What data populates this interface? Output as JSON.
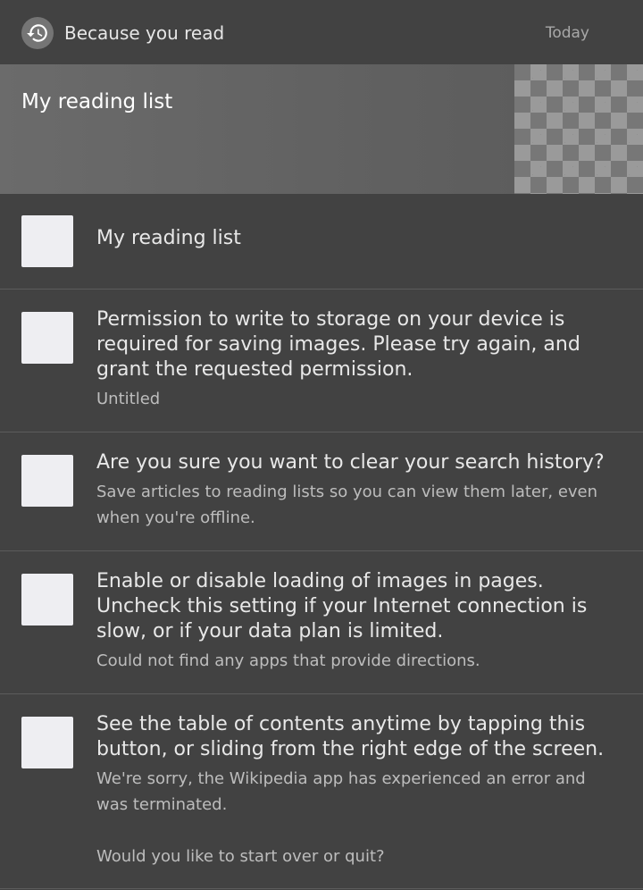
{
  "header": {
    "icon": "history-icon",
    "title": "Because you read",
    "date": "Today"
  },
  "banner": {
    "title": "My reading list",
    "thumbnail": "placeholder-image"
  },
  "items": [
    {
      "title": "My reading list",
      "subtitle": ""
    },
    {
      "title": "Permission to write to storage on your device is required for saving images. Please try again, and grant the requested permission.",
      "subtitle": "Untitled"
    },
    {
      "title": "Are you sure you want to clear your search history?",
      "subtitle": "Save articles to reading lists so you can view them later, even when you're offline."
    },
    {
      "title": "Enable or disable loading of images in pages. Uncheck this setting if your Internet connection is slow, or if your data plan is limited.",
      "subtitle": "Could not find any apps that provide directions."
    },
    {
      "title": "See the table of contents anytime by tapping this button, or sliding from the right edge of the screen.",
      "subtitle": "We're sorry, the Wikipedia app has experienced an error and was terminated.\n\nWould you like to start over or quit?"
    }
  ]
}
